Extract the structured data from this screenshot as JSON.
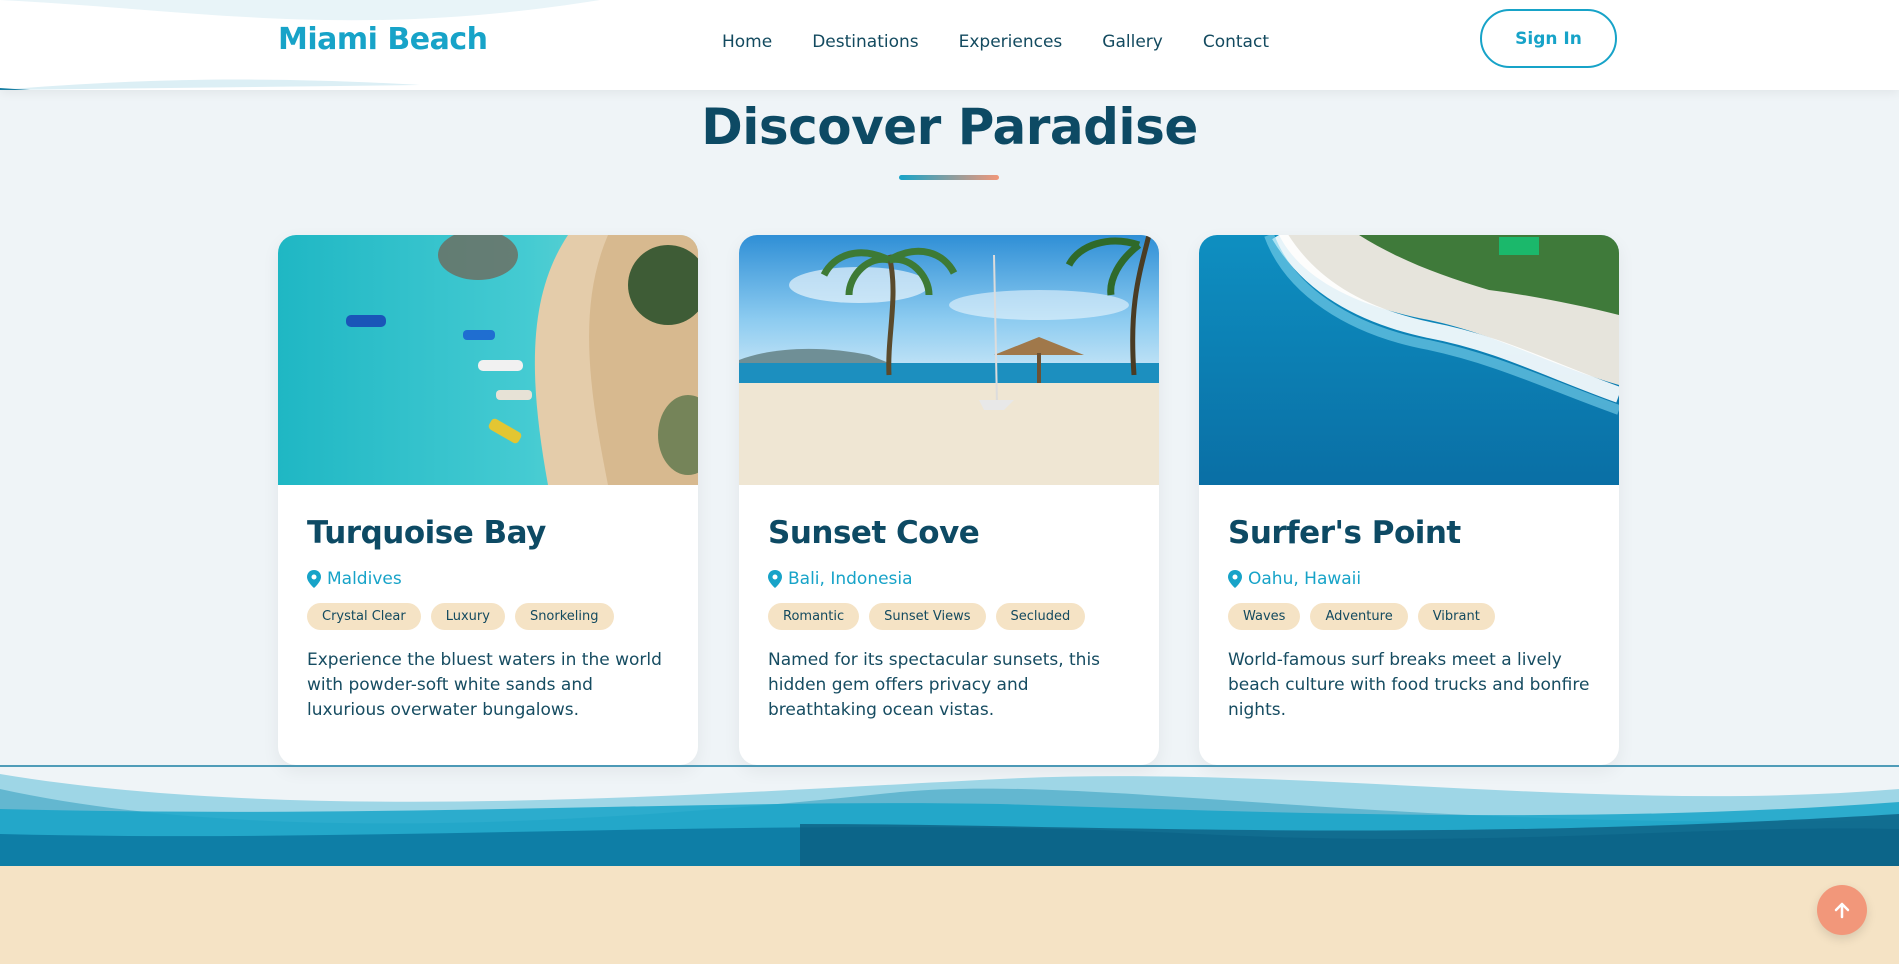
{
  "header": {
    "logo": "Miami Beach",
    "nav": [
      "Home",
      "Destinations",
      "Experiences",
      "Gallery",
      "Contact"
    ],
    "signin_label": "Sign In"
  },
  "section": {
    "title": "Discover Paradise"
  },
  "cards": [
    {
      "title": "Turquoise Bay",
      "location": "Maldives",
      "tags": [
        "Crystal Clear",
        "Luxury",
        "Snorkeling"
      ],
      "description": "Experience the bluest waters in the world with powder-soft white sands and luxurious overwater bungalows."
    },
    {
      "title": "Sunset Cove",
      "location": "Bali, Indonesia",
      "tags": [
        "Romantic",
        "Sunset Views",
        "Secluded"
      ],
      "description": "Named for its spectacular sunsets, this hidden gem offers privacy and breathtaking ocean vistas."
    },
    {
      "title": "Surfer's Point",
      "location": "Oahu, Hawaii",
      "tags": [
        "Waves",
        "Adventure",
        "Vibrant"
      ],
      "description": "World-famous surf breaks meet a lively beach culture with food trucks and bonfire nights."
    }
  ],
  "colors": {
    "accent": "#17a3c8",
    "dark": "#0d4a64",
    "sand": "#f5e3c5",
    "coral": "#f2977a"
  },
  "icons": {
    "location": "map-pin-icon",
    "scroll_top": "arrow-up-icon"
  }
}
